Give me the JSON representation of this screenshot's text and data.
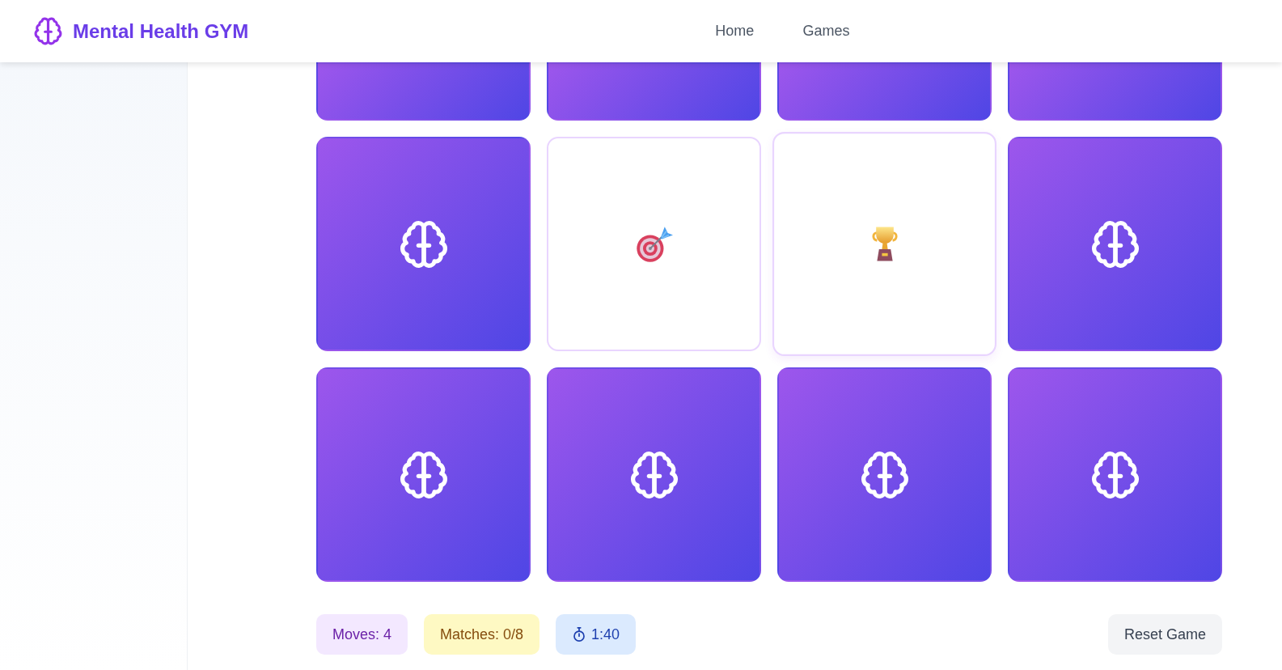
{
  "header": {
    "brand": "Mental Health GYM",
    "nav": [
      {
        "label": "Home"
      },
      {
        "label": "Games"
      }
    ]
  },
  "board": {
    "partly_visible_cards": [
      {
        "flipped": false
      },
      {
        "flipped": false
      },
      {
        "flipped": false
      },
      {
        "flipped": false
      }
    ],
    "cards": [
      {
        "flipped": false,
        "hovered": false
      },
      {
        "flipped": true,
        "hovered": false,
        "kind": "target"
      },
      {
        "flipped": true,
        "hovered": true,
        "kind": "trophy"
      },
      {
        "flipped": false,
        "hovered": false
      },
      {
        "flipped": false,
        "hovered": false
      },
      {
        "flipped": false,
        "hovered": false
      },
      {
        "flipped": false,
        "hovered": false
      },
      {
        "flipped": false,
        "hovered": false
      }
    ]
  },
  "stats": [
    {
      "kind": "moves",
      "label": "Moves: 4"
    },
    {
      "kind": "matches",
      "label": "Matches: 0/8"
    },
    {
      "kind": "timer",
      "label": "1:40"
    }
  ],
  "reset_button": "Reset Game"
}
